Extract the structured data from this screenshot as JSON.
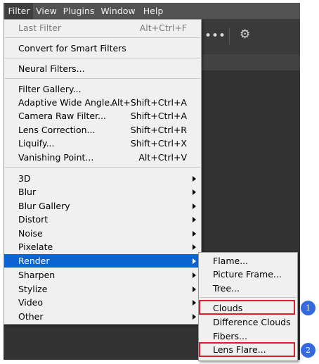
{
  "menubar": {
    "items": [
      "Filter",
      "View",
      "Plugins",
      "Window",
      "Help"
    ]
  },
  "toolbar": {
    "icons": [
      "more-icon",
      "gear-icon"
    ]
  },
  "filter_menu": {
    "last_filter": {
      "label": "Last Filter",
      "shortcut": "Alt+Ctrl+F"
    },
    "convert_smart": "Convert for Smart Filters",
    "neural_filters": "Neural Filters...",
    "filter_gallery": "Filter Gallery...",
    "adaptive_wide_angle": {
      "label": "Adaptive Wide Angle...",
      "shortcut": "Alt+Shift+Ctrl+A"
    },
    "camera_raw": {
      "label": "Camera Raw Filter...",
      "shortcut": "Shift+Ctrl+A"
    },
    "lens_correction": {
      "label": "Lens Correction...",
      "shortcut": "Shift+Ctrl+R"
    },
    "liquify": {
      "label": "Liquify...",
      "shortcut": "Shift+Ctrl+X"
    },
    "vanishing_point": {
      "label": "Vanishing Point...",
      "shortcut": "Alt+Ctrl+V"
    },
    "submenus": [
      "3D",
      "Blur",
      "Blur Gallery",
      "Distort",
      "Noise",
      "Pixelate",
      "Render",
      "Sharpen",
      "Stylize",
      "Video",
      "Other"
    ]
  },
  "render_submenu": {
    "items_top": [
      "Flame...",
      "Picture Frame...",
      "Tree..."
    ],
    "items_bottom": [
      "Clouds",
      "Difference Clouds",
      "Fibers...",
      "Lens Flare..."
    ]
  },
  "annotations": {
    "marker_1": "1",
    "marker_2": "2",
    "color": "#d9202a",
    "marker_color": "#3569e0"
  },
  "colors": {
    "highlight": "#0a64d2",
    "menu_bg": "#f0f0f0",
    "app_bg": "#323232"
  }
}
